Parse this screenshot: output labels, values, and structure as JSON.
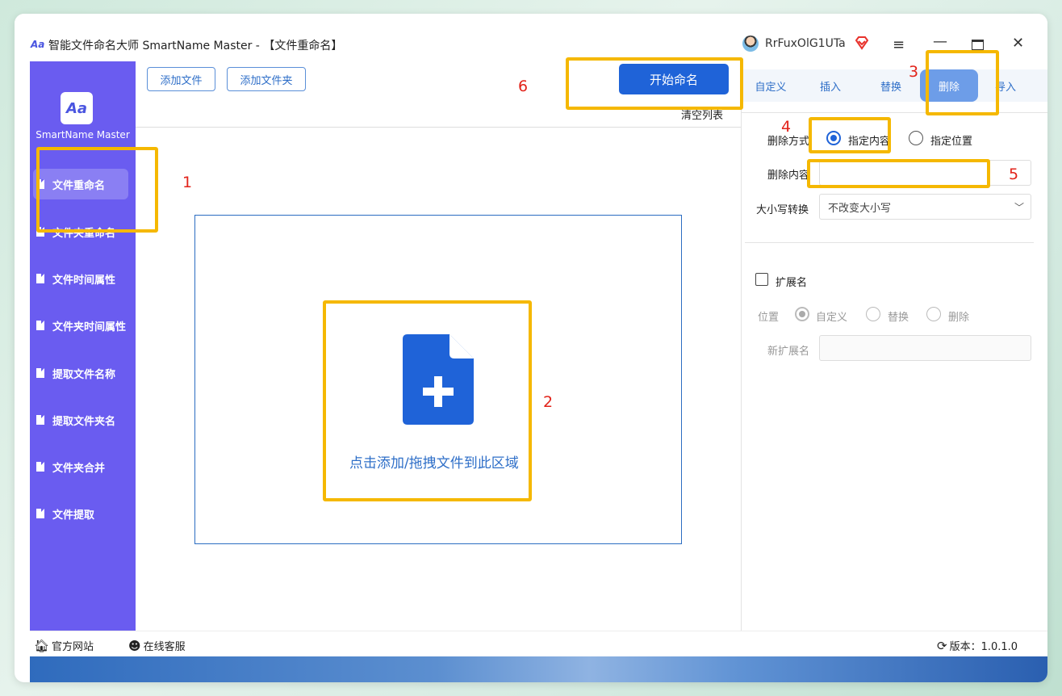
{
  "window": {
    "title": "智能文件命名大师 SmartName Master - 【文件重命名】",
    "username": "RrFuxOlG1UTa"
  },
  "sidebar": {
    "app_name": "SmartName Master",
    "items": [
      {
        "label": "文件重命名",
        "active": true
      },
      {
        "label": "文件夹重命名",
        "active": false
      },
      {
        "label": "文件时间属性",
        "active": false
      },
      {
        "label": "文件夹时间属性",
        "active": false
      },
      {
        "label": "提取文件名称",
        "active": false
      },
      {
        "label": "提取文件夹名",
        "active": false
      },
      {
        "label": "文件夹合并",
        "active": false
      },
      {
        "label": "文件提取",
        "active": false
      }
    ]
  },
  "toolbar": {
    "add_file": "添加文件",
    "add_folder": "添加文件夹",
    "start": "开始命名",
    "clear_list": "清空列表"
  },
  "dropzone": {
    "text": "点击添加/拖拽文件到此区域"
  },
  "tabs": [
    {
      "label": "自定义",
      "active": false
    },
    {
      "label": "插入",
      "active": false
    },
    {
      "label": "替换",
      "active": false
    },
    {
      "label": "删除",
      "active": true
    },
    {
      "label": "导入",
      "active": false
    }
  ],
  "delete_panel": {
    "mode_label": "删除方式",
    "mode_options": [
      "指定内容",
      "指定位置"
    ],
    "mode_selected": "指定内容",
    "content_label": "删除内容",
    "content_value": "",
    "case_label": "大小写转换",
    "case_value": "不改变大小写"
  },
  "extension": {
    "checkbox_label": "扩展名",
    "checked": false,
    "position_label": "位置",
    "position_options": [
      "自定义",
      "替换",
      "删除"
    ],
    "position_selected": "自定义",
    "new_ext_label": "新扩展名",
    "new_ext_value": ""
  },
  "statusbar": {
    "website": "官方网站",
    "support": "在线客服",
    "version": "版本：1.0.1.0"
  },
  "annotations": [
    "1",
    "2",
    "3",
    "4",
    "5",
    "6"
  ],
  "colors": {
    "sidebar": "#6a5cf0",
    "primary": "#1f63d8",
    "highlight": "#f5b800",
    "annotation_text": "#e2231a"
  }
}
